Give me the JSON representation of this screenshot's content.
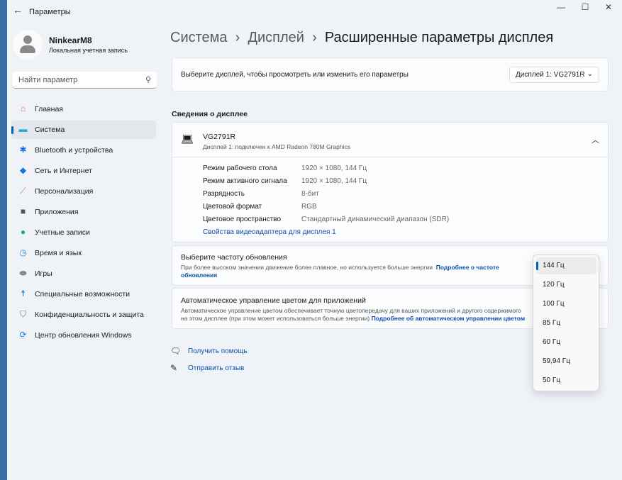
{
  "window": {
    "title": "Параметры",
    "controls": {
      "minimize": "—",
      "maximize": "☐",
      "close": "✕"
    }
  },
  "user": {
    "name": "NinkearM8",
    "type": "Локальная учетная запись"
  },
  "search": {
    "placeholder": "Найти параметр"
  },
  "nav": [
    {
      "label": "Главная",
      "icon": "home-icon",
      "glyph": "⌂",
      "color": "#e8743b"
    },
    {
      "label": "Система",
      "icon": "system-icon",
      "glyph": "▬",
      "color": "#2aa6d8",
      "selected": true
    },
    {
      "label": "Bluetooth и устройства",
      "icon": "bluetooth-icon",
      "glyph": "✱",
      "color": "#1a73e8"
    },
    {
      "label": "Сеть и Интернет",
      "icon": "wifi-icon",
      "glyph": "◆",
      "color": "#1a73e8"
    },
    {
      "label": "Персонализация",
      "icon": "brush-icon",
      "glyph": "⟋",
      "color": "#e8743b"
    },
    {
      "label": "Приложения",
      "icon": "apps-icon",
      "glyph": "■",
      "color": "#555"
    },
    {
      "label": "Учетные записи",
      "icon": "accounts-icon",
      "glyph": "●",
      "color": "#1fa39a"
    },
    {
      "label": "Время и язык",
      "icon": "time-language-icon",
      "glyph": "◷",
      "color": "#2a8ad8"
    },
    {
      "label": "Игры",
      "icon": "gamepad-icon",
      "glyph": "⬬",
      "color": "#888"
    },
    {
      "label": "Специальные возможности",
      "icon": "accessibility-icon",
      "glyph": "☨",
      "color": "#1a73e8"
    },
    {
      "label": "Конфиденциальность и защита",
      "icon": "shield-icon",
      "glyph": "⛉",
      "color": "#777"
    },
    {
      "label": "Центр обновления Windows",
      "icon": "update-icon",
      "glyph": "⟳",
      "color": "#1a73e8"
    }
  ],
  "breadcrumb": [
    "Система",
    "Дисплей",
    "Расширенные параметры дисплея"
  ],
  "select_display": {
    "label": "Выберите дисплей, чтобы просмотреть или изменить его параметры",
    "value": "Дисплей 1: VG2791R"
  },
  "info_heading": "Сведения о дисплее",
  "display": {
    "name": "VG2791R",
    "subtitle": "Дисплей 1: подключен к AMD Radeon 780M Graphics",
    "rows": [
      {
        "k": "Режим рабочего стола",
        "v": "1920 × 1080, 144 Гц"
      },
      {
        "k": "Режим активного сигнала",
        "v": "1920 × 1080, 144 Гц"
      },
      {
        "k": "Разрядность",
        "v": "8-бит"
      },
      {
        "k": "Цветовой формат",
        "v": "RGB"
      },
      {
        "k": "Цветовое пространство",
        "v": "Стандартный динамический диапазон (SDR)"
      }
    ],
    "adapter_link": "Свойства видеоадаптера для дисплея 1"
  },
  "refresh": {
    "title": "Выберите частоту обновления",
    "desc": "При более высоком значении движение более плавное, но используется больше энергии",
    "link1": "Подробнее о частоте",
    "link2": "обновления"
  },
  "acm": {
    "title": "Автоматическое управление цветом для приложений",
    "desc1": "Автоматическое управление цветом обеспечивает точную цветопередачу для ваших приложений и другого содержимого",
    "desc2": "на этом дисплее (при этом может использоваться больше энергии)",
    "link": "Подробнее об автоматическом управлении цветом"
  },
  "help": {
    "get_help": "Получить помощь",
    "feedback": "Отправить отзыв"
  },
  "refresh_options": [
    "144 Гц",
    "120 Гц",
    "100 Гц",
    "85 Гц",
    "60 Гц",
    "59,94 Гц",
    "50 Гц"
  ],
  "accent": "#005fb8"
}
